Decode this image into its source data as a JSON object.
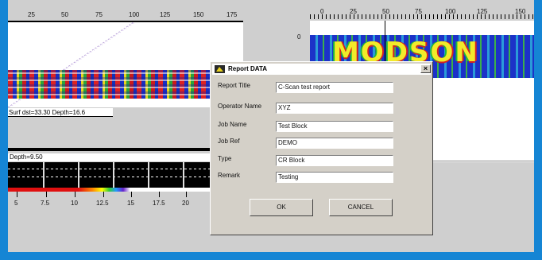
{
  "left_panel": {
    "ruler_ticks": [
      "25",
      "50",
      "75",
      "100",
      "125",
      "150",
      "175"
    ],
    "surf_readout": "Surf dst=33.30 Depth=16.6",
    "depth_readout": "Depth=9.50",
    "bottom_ticks": [
      "5",
      "7.5",
      "10",
      "12.5",
      "15",
      "17.5",
      "20"
    ]
  },
  "right_panel": {
    "ruler_ticks": [
      "0",
      "25",
      "50",
      "75",
      "100",
      "125",
      "150"
    ],
    "side_tick": "0",
    "cscan_letters": "MODSON"
  },
  "dialog": {
    "title": "Report DATA",
    "close_glyph": "×",
    "fields": [
      {
        "label": "Report Title",
        "value": "C-Scan test report"
      },
      {
        "label": "Operator Name",
        "value": "XYZ"
      },
      {
        "label": "Job Name",
        "value": "Test Block"
      },
      {
        "label": "Job Ref",
        "value": "DEMO"
      },
      {
        "label": "Type",
        "value": "CR Block"
      },
      {
        "label": "Remark",
        "value": "Testing"
      }
    ],
    "ok_label": "OK",
    "cancel_label": "CANCEL"
  },
  "colors": {
    "frame_accent": "#1585d4",
    "dialog_face": "#d4d0c8"
  }
}
